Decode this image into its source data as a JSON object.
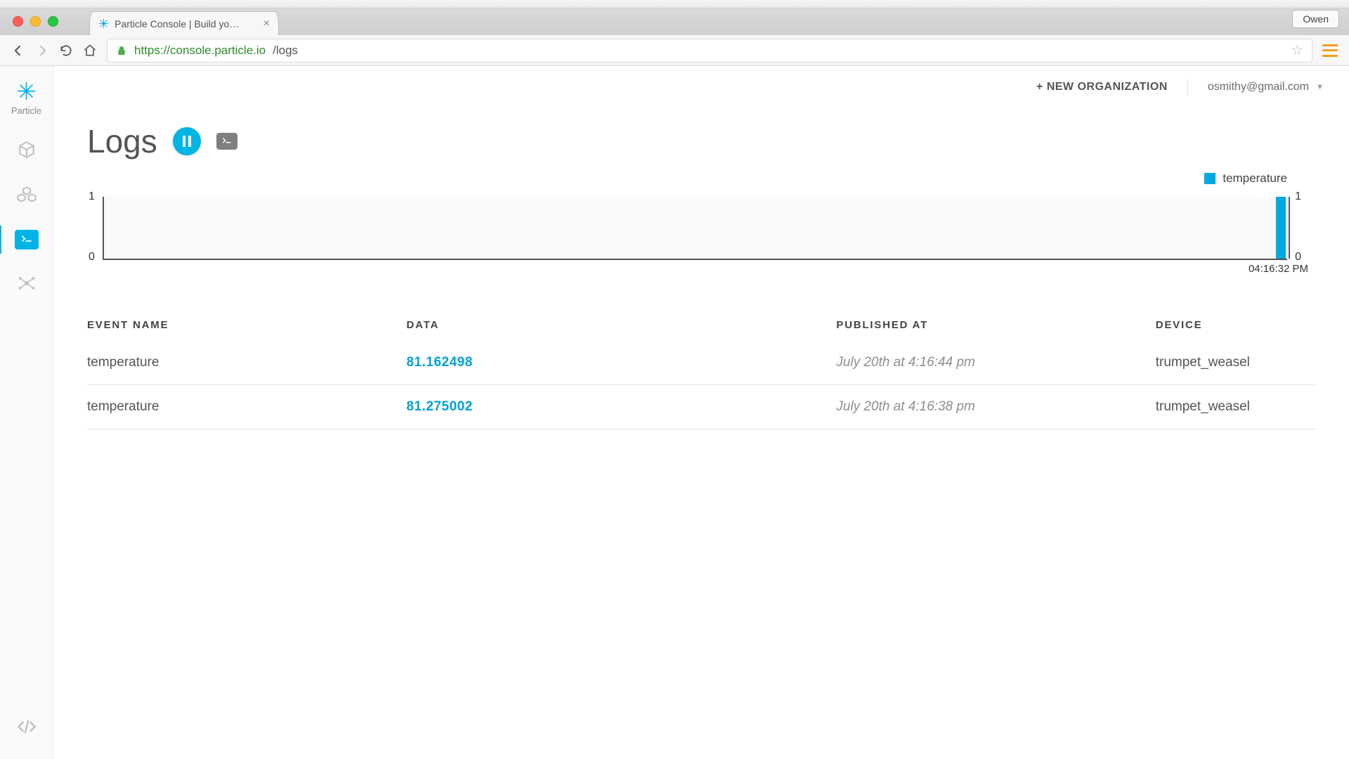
{
  "browser": {
    "tab_title": "Particle Console | Build yo…",
    "profile": "Owen",
    "url_host": "https://console.particle.io",
    "url_path": "/logs"
  },
  "sidebar": {
    "brand": "Particle",
    "items": [
      {
        "id": "devices",
        "label": "Devices"
      },
      {
        "id": "products",
        "label": "Products"
      },
      {
        "id": "logs",
        "label": "Logs",
        "active": true
      },
      {
        "id": "integrations",
        "label": "Integrations"
      }
    ],
    "bottom": {
      "id": "ide",
      "label": "Web IDE"
    }
  },
  "header": {
    "new_org": "+ NEW ORGANIZATION",
    "account": "osmithy@gmail.com"
  },
  "page": {
    "title": "Logs"
  },
  "chart_data": {
    "type": "bar",
    "title": "",
    "xlabel": "",
    "ylabel": "",
    "ylim": [
      0,
      1
    ],
    "right_ylim": [
      0,
      1
    ],
    "categories": [
      "04:16:32 PM"
    ],
    "series": [
      {
        "name": "temperature",
        "values": [
          1
        ],
        "color": "#00a9e0"
      }
    ],
    "legend_position": "top-right",
    "x_tick_label": "04:16:32 PM"
  },
  "table": {
    "columns": [
      "EVENT NAME",
      "DATA",
      "PUBLISHED AT",
      "DEVICE"
    ],
    "rows": [
      {
        "event": "temperature",
        "data": "81.162498",
        "published": "July 20th at 4:16:44 pm",
        "device": "trumpet_weasel"
      },
      {
        "event": "temperature",
        "data": "81.275002",
        "published": "July 20th at 4:16:38 pm",
        "device": "trumpet_weasel"
      }
    ]
  }
}
